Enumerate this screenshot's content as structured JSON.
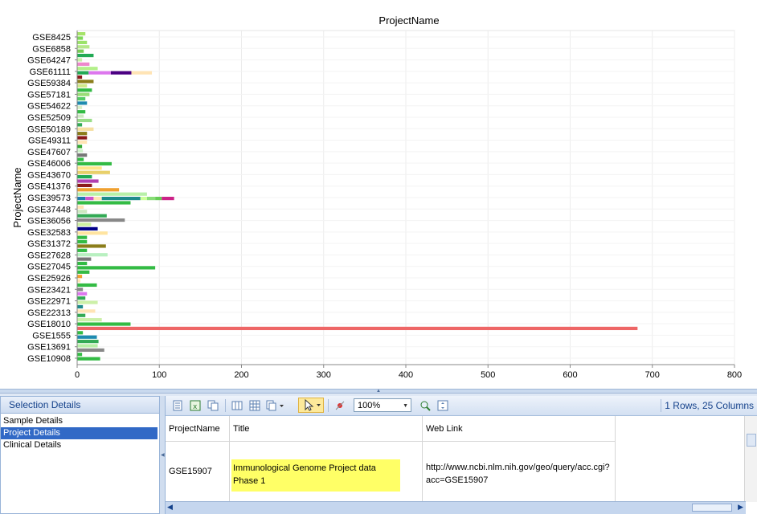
{
  "chart_data": {
    "type": "bar",
    "orientation": "horizontal-stacked",
    "title": "ProjectName",
    "ylabel": "ProjectName",
    "xlabel": "",
    "xlim": [
      0,
      800
    ],
    "x_ticks": [
      0,
      100,
      200,
      300,
      400,
      500,
      600,
      700,
      800
    ],
    "grid": true,
    "categories": [
      "GSE8425",
      "GSE6858",
      "GSE64247",
      "GSE61111",
      "GSE59384",
      "GSE57181",
      "GSE54622",
      "GSE52509",
      "GSE50189",
      "GSE49311",
      "GSE47607",
      "GSE46006",
      "GSE43670",
      "GSE41376",
      "GSE39573",
      "GSE37448",
      "GSE36056",
      "GSE32583",
      "GSE31372",
      "GSE27628",
      "GSE27045",
      "GSE25926",
      "GSE23421",
      "GSE22971",
      "GSE22313",
      "GSE18010",
      "GSE1555",
      "GSE13691",
      "GSE10908"
    ],
    "bars": [
      [
        [
          10,
          "#a6e36a"
        ]
      ],
      [
        [
          7,
          "#7ed957"
        ]
      ],
      [
        [
          12,
          "#9be36a"
        ]
      ],
      [
        [
          15,
          "#b5e88a"
        ]
      ],
      [
        [
          8,
          "#77cc55"
        ]
      ],
      [
        [
          20,
          "#22aa55"
        ]
      ],
      [
        [
          6,
          "#c8f0a8"
        ]
      ],
      [
        [
          15,
          "#ee88cc"
        ]
      ],
      [
        [
          25,
          "#b3f08a"
        ]
      ],
      [
        [
          14,
          "#22aa55"
        ],
        [
          27,
          "#dd77ee"
        ],
        [
          25,
          "#4b0082"
        ],
        [
          25,
          "#ffe4b5"
        ]
      ],
      [
        [
          6,
          "#8b1a1a"
        ]
      ],
      [
        [
          20,
          "#8b7d1a"
        ]
      ],
      [
        [
          12,
          "#cfe88a"
        ]
      ],
      [
        [
          18,
          "#33bb44"
        ]
      ],
      [
        [
          15,
          "#99dd77"
        ]
      ],
      [
        [
          10,
          "#55cc66"
        ]
      ],
      [
        [
          12,
          "#1e8bb0"
        ]
      ],
      [
        [
          6,
          "#d8f0c8"
        ]
      ],
      [
        [
          10,
          "#33bb44"
        ]
      ],
      [
        [
          8,
          "#cce8c0"
        ]
      ],
      [
        [
          18,
          "#99dd88"
        ]
      ],
      [
        [
          6,
          "#33aa55"
        ]
      ],
      [
        [
          20,
          "#f5dfa0"
        ]
      ],
      [
        [
          12,
          "#8b7d1a"
        ]
      ],
      [
        [
          12,
          "#8b1a1a"
        ]
      ],
      [
        [
          12,
          "#ffe4b5"
        ]
      ],
      [
        [
          6,
          "#33aa33"
        ]
      ],
      [
        [
          7,
          "#ccf0c8"
        ]
      ],
      [
        [
          12,
          "#777777"
        ]
      ],
      [
        [
          8,
          "#33bb44"
        ]
      ],
      [
        [
          42,
          "#33bb44"
        ]
      ],
      [
        [
          30,
          "#ffe68a"
        ]
      ],
      [
        [
          40,
          "#e8d06a"
        ]
      ],
      [
        [
          18,
          "#22aa55"
        ]
      ],
      [
        [
          26,
          "#b03fb0"
        ]
      ],
      [
        [
          18,
          "#8b1a1a"
        ]
      ],
      [
        [
          51,
          "#f0a030"
        ]
      ],
      [
        [
          85,
          "#b8f0a8"
        ]
      ],
      [
        [
          10,
          "#1e7bb0"
        ],
        [
          10,
          "#cc55cc"
        ],
        [
          10,
          "#ffe4b5"
        ],
        [
          47,
          "#1e8b8b"
        ],
        [
          8,
          "#ccff99"
        ],
        [
          10,
          "#88dd77"
        ],
        [
          8,
          "#66cc55"
        ],
        [
          15,
          "#cc2288"
        ]
      ],
      [
        [
          65,
          "#33bb44"
        ]
      ],
      [
        [
          8,
          "#ffe4b5"
        ]
      ],
      [
        [
          12,
          "#cce8c0"
        ]
      ],
      [
        [
          36,
          "#33aa55"
        ]
      ],
      [
        [
          58,
          "#888888"
        ]
      ],
      [
        [
          17,
          "#ccf0a0"
        ]
      ],
      [
        [
          25,
          "#000088"
        ]
      ],
      [
        [
          37,
          "#ffe4a0"
        ]
      ],
      [
        [
          12,
          "#33bb44"
        ]
      ],
      [
        [
          12,
          "#33bb44"
        ]
      ],
      [
        [
          35,
          "#8b7d1a"
        ]
      ],
      [
        [
          12,
          "#33bb44"
        ]
      ],
      [
        [
          37,
          "#b8f0c0"
        ]
      ],
      [
        [
          17,
          "#777777"
        ]
      ],
      [
        [
          12,
          "#33bb44"
        ]
      ],
      [
        [
          95,
          "#33bb44"
        ]
      ],
      [
        [
          15,
          "#33bb44"
        ]
      ],
      [
        [
          6,
          "#f0a030"
        ]
      ],
      [
        [
          4,
          "#ffe4b5"
        ]
      ],
      [
        [
          24,
          "#33bb44"
        ]
      ],
      [
        [
          7,
          "#888888"
        ]
      ],
      [
        [
          12,
          "#dd77ee"
        ]
      ],
      [
        [
          10,
          "#33aa55"
        ]
      ],
      [
        [
          25,
          "#ccf0a8"
        ]
      ],
      [
        [
          7,
          "#1e8b8b"
        ]
      ],
      [
        [
          22,
          "#ffe4b5"
        ]
      ],
      [
        [
          10,
          "#33aa55"
        ]
      ],
      [
        [
          30,
          "#ccf0a8"
        ]
      ],
      [
        [
          65,
          "#33bb44"
        ]
      ],
      [
        [
          682,
          "#ee6666"
        ]
      ],
      [
        [
          7,
          "#33bb44"
        ]
      ],
      [
        [
          24,
          "#1e8bb0"
        ]
      ],
      [
        [
          26,
          "#33aa55"
        ]
      ],
      [
        [
          25,
          "#b8f0a8"
        ]
      ],
      [
        [
          33,
          "#888888"
        ]
      ],
      [
        [
          6,
          "#33bb44"
        ]
      ],
      [
        [
          28,
          "#33bb44"
        ]
      ]
    ]
  },
  "selection_details": {
    "header": "Selection Details",
    "items": [
      "Sample Details",
      "Project Details",
      "Clinical Details"
    ],
    "selected_index": 1
  },
  "toolbar": {
    "zoom": "100%",
    "row_count": "1 Rows, 25 Columns"
  },
  "table": {
    "columns": [
      "ProjectName",
      "Title",
      "Web Link"
    ],
    "rows": [
      {
        "project": "GSE15907",
        "title": "Immunological Genome Project data Phase 1",
        "link": "http://www.ncbi.nlm.nih.gov/geo/query/acc.cgi?acc=GSE15907"
      }
    ]
  }
}
